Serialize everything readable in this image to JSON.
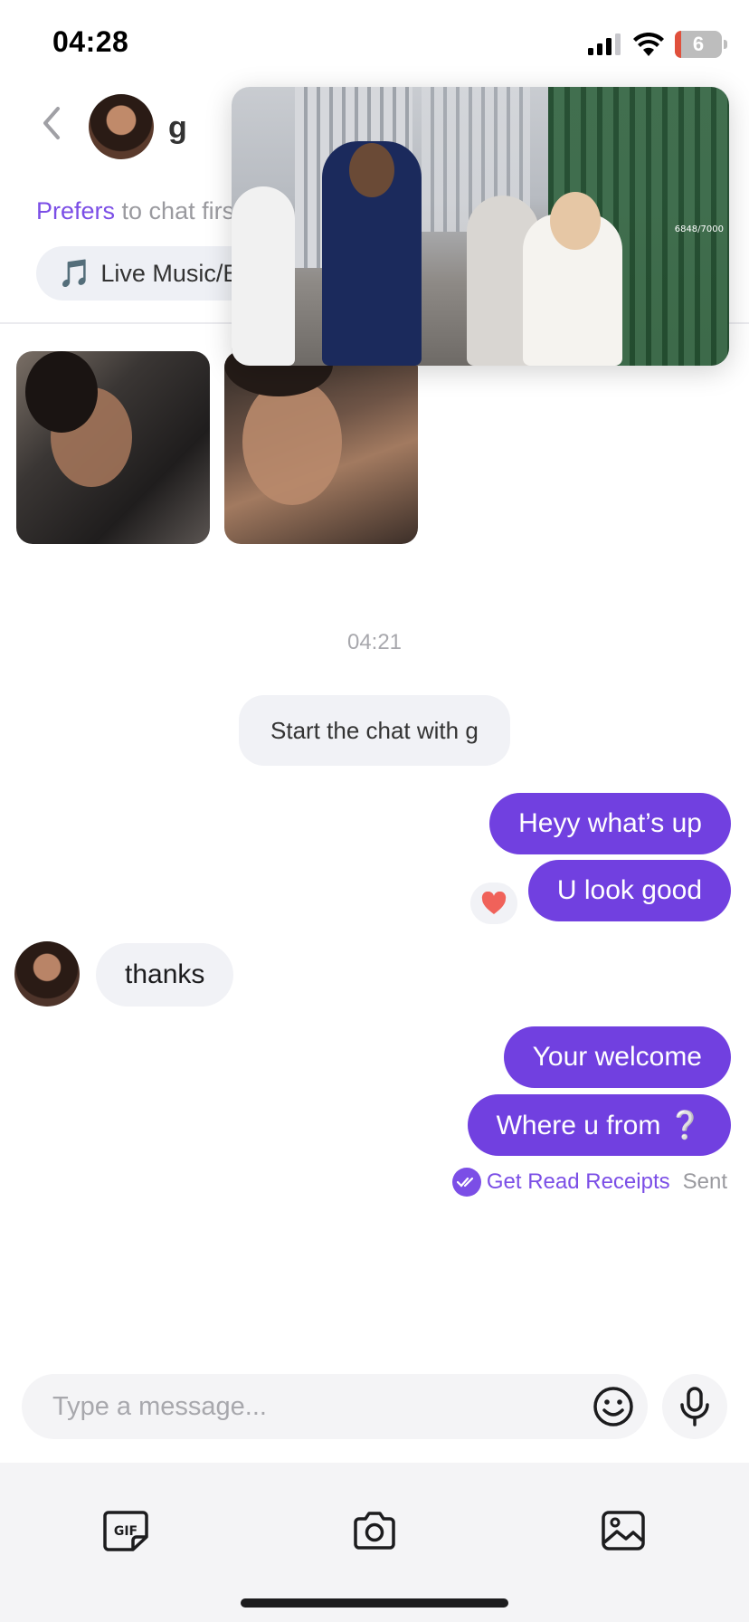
{
  "status_bar": {
    "time": "04:28",
    "battery": "6"
  },
  "header": {
    "name": "g",
    "prefers_accent": "Prefers",
    "prefers_rest": " to chat first",
    "interest_chip": "Live Music/Ev"
  },
  "pip": {
    "counter": "6848/7000"
  },
  "chat": {
    "timestamp": "04:21",
    "system_message": "Start the chat with g",
    "messages": [
      {
        "from": "me",
        "text": "Heyy what’s up"
      },
      {
        "from": "me",
        "text": "U look good",
        "reaction": "heart"
      },
      {
        "from": "them",
        "text": "thanks"
      },
      {
        "from": "me",
        "text": "Your welcome"
      },
      {
        "from": "me",
        "text": "Where u from  ❔"
      }
    ],
    "read_receipts_link": "Get Read Receipts",
    "status": "Sent"
  },
  "composer": {
    "placeholder": "Type a message..."
  },
  "toolbar": {
    "gif_label": "GIF"
  },
  "colors": {
    "accent": "#7140e0",
    "bubble_in": "#f1f2f6",
    "heart": "#f0625a"
  }
}
